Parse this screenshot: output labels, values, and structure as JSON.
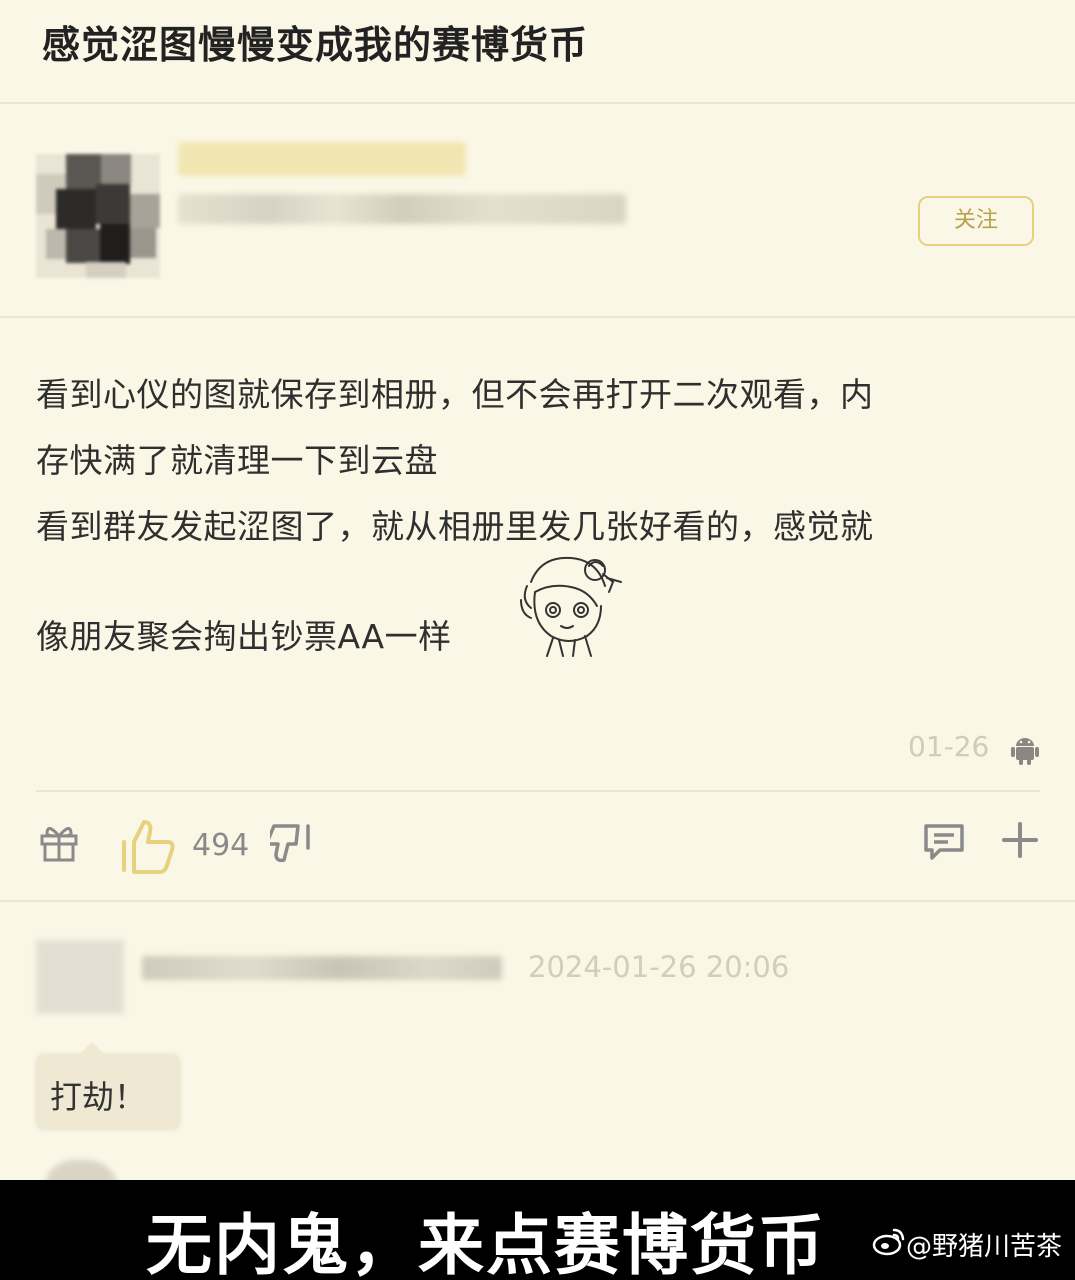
{
  "topic": {
    "title": "感觉涩图慢慢变成我的赛博货币"
  },
  "author": {
    "follow_label": "关注"
  },
  "post": {
    "lines": [
      "看到心仪的图就保存到相册，但不会再打开二次观看，内",
      "存快满了就清理一下到云盘",
      "看到群友发起涩图了，就从相册里发几张好看的，感觉就",
      "像朋友聚会掏出钞票AA一样"
    ],
    "date": "01-26",
    "device_icon": "android-icon"
  },
  "actions": {
    "gift_icon": "gift-icon",
    "like_icon": "thumbs-up-icon",
    "like_count": "494",
    "dislike_icon": "thumbs-down-icon",
    "comment_icon": "comment-icon",
    "more_icon": "plus-icon"
  },
  "reply": {
    "time": "2024-01-26 20:06",
    "text": "打劫！"
  },
  "caption": {
    "text": "无内鬼，来点赛博货币"
  },
  "watermark": {
    "text": "@野猪川苦茶",
    "logo": "weibo-logo"
  },
  "colors": {
    "background": "#fbf7e6",
    "follow_border": "#e4d27c",
    "follow_text": "#b8a14a",
    "caption_bg": "#000000"
  }
}
